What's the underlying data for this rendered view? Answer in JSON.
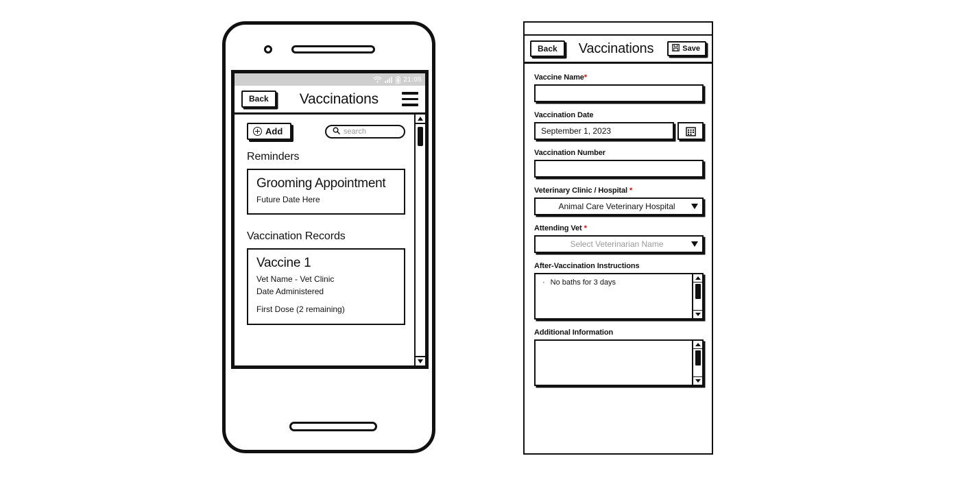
{
  "phone": {
    "statusbar": {
      "wifi_icon": "wifi-icon",
      "signal_icon": "signal-bars-icon",
      "battery_icon": "battery-icon",
      "time": "21:05"
    },
    "appbar": {
      "back_label": "Back",
      "title": "Vaccinations",
      "menu_icon": "hamburger-menu-icon"
    },
    "toolbar": {
      "add_label": "Add",
      "add_icon": "plus-circle-icon",
      "search_icon": "search-icon",
      "search_placeholder": "search",
      "search_value": ""
    },
    "sections": [
      {
        "heading": "Reminders",
        "card": {
          "title": "Grooming Appointment",
          "lines": [
            "Future Date Here"
          ]
        }
      },
      {
        "heading": "Vaccination Records",
        "card": {
          "title": "Vaccine 1",
          "lines": [
            "Vet Name - Vet Clinic",
            "Date Administered"
          ],
          "footer": "First Dose (2 remaining)"
        }
      }
    ],
    "scrollbar": {
      "up_icon": "scroll-up-arrow-icon",
      "down_icon": "scroll-down-arrow-icon"
    }
  },
  "form": {
    "appbar": {
      "back_label": "Back",
      "title": "Vaccinations",
      "save_label": "Save",
      "save_icon": "floppy-disk-icon"
    },
    "fields": {
      "vaccine_name": {
        "label": "Vaccine Name",
        "required": true,
        "required_mark": "*",
        "value": ""
      },
      "vaccination_date": {
        "label": "Vaccination Date",
        "required": false,
        "value": "September 1, 2023",
        "calendar_icon": "calendar-icon"
      },
      "vaccination_number": {
        "label": "Vaccination Number",
        "required": false,
        "value": ""
      },
      "clinic": {
        "label": "Veterinary Clinic / Hospital",
        "required": true,
        "required_mark": "*",
        "value": "Animal Care Veterinary Hospital",
        "is_placeholder": false,
        "caret_icon": "chevron-down-icon"
      },
      "attending_vet": {
        "label": "Attending Vet",
        "required": true,
        "required_mark": "*",
        "value": "Select Veterinarian Name",
        "is_placeholder": true,
        "caret_icon": "chevron-down-icon"
      },
      "instructions": {
        "label": "After-Vaccination Instructions",
        "required": false,
        "bullet": "·",
        "items": [
          "No baths for 3 days"
        ]
      },
      "additional_info": {
        "label": "Additional Information",
        "required": false,
        "items": []
      }
    }
  },
  "colors": {
    "ink": "#111111",
    "required": "#e60000",
    "placeholder": "#9a9a9a",
    "statusbar_bg": "#cfcfcf"
  }
}
